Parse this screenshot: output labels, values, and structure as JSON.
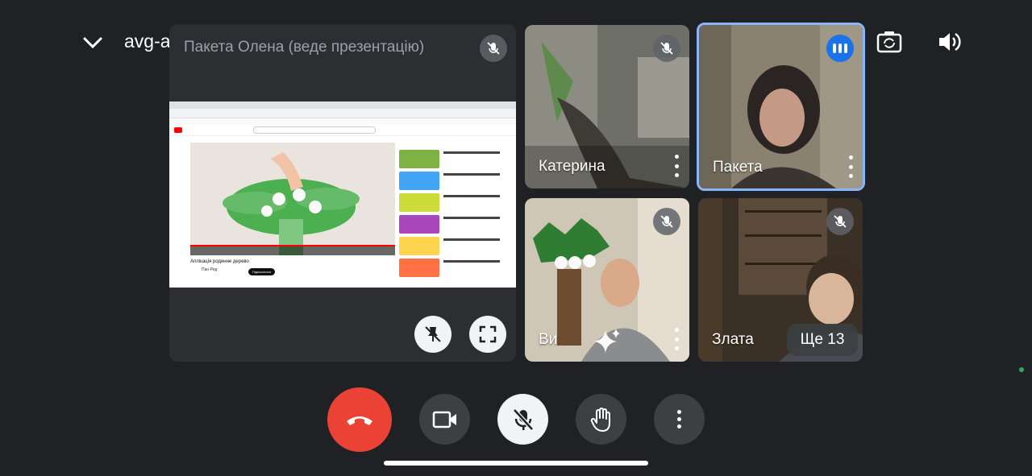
{
  "meeting": {
    "code": "avg-aiiu-xwg"
  },
  "presentation": {
    "presenter_label": "Пакета Олена (веде презентацію)",
    "video_title": "Аплікація родинне дерево",
    "channel_name": "Пан Ред",
    "subscribe_label": "Підписатися"
  },
  "participants": [
    {
      "name": "Катерина",
      "muted": true
    },
    {
      "name": "Пакета",
      "muted": false,
      "speaking": true
    },
    {
      "name": "Ви",
      "muted": true
    },
    {
      "name": "Злата",
      "muted": true
    }
  ],
  "more_participants": "Ще 13",
  "colors": {
    "background": "#202124",
    "tile": "#3c4043",
    "end_call": "#ea4335",
    "active_speaker_border": "#8ab4f8",
    "speaking_badge": "#1a73e8"
  },
  "icons": {
    "collapse": "chevron-down-icon",
    "cast": "cast-arrow-icon",
    "camera_flip": "camera-flip-icon",
    "audio": "volume-icon",
    "unpin": "unpin-icon",
    "fullscreen": "fullscreen-icon",
    "effects": "sparkle-icon"
  }
}
